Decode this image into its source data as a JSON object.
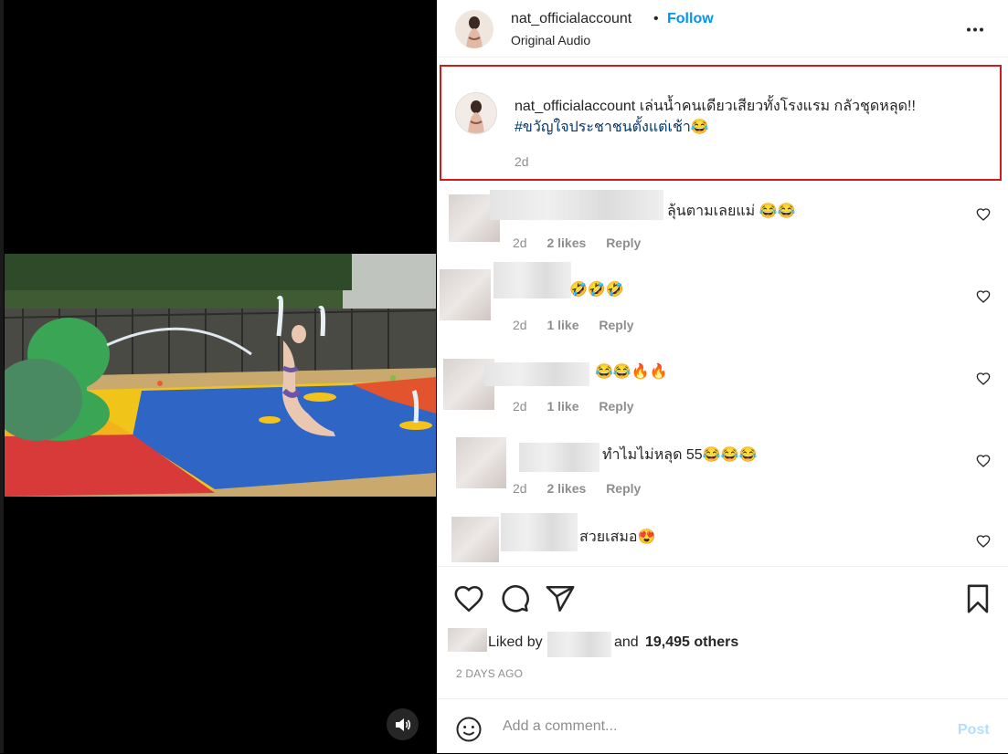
{
  "post": {
    "username": "nat_officialaccount",
    "dot": "•",
    "follow_label": "Follow",
    "audio_label": "Original Audio"
  },
  "caption": {
    "username": "nat_officialaccount",
    "text": "เล่นน้ำคนเดียวเสียวทั้งโรงแรม กลัวชุดหลุด!!",
    "hashtag": "#ขวัญใจประชาชนตั้งแต่เช้า😂",
    "time": "2d"
  },
  "comments": [
    {
      "text": "ลุ้นตามเลยแม่ 😂😂",
      "time": "2d",
      "likes": "2 likes",
      "reply": "Reply"
    },
    {
      "text": "🤣🤣🤣",
      "time": "2d",
      "likes": "1 like",
      "reply": "Reply"
    },
    {
      "text": "😂😂🔥🔥",
      "time": "2d",
      "likes": "1 like",
      "reply": "Reply"
    },
    {
      "text": "ทำไมไม่หลุด 55😂😂😂",
      "time": "2d",
      "likes": "2 likes",
      "reply": "Reply"
    },
    {
      "text": "สวยเสมอ😍",
      "time": "",
      "likes": "",
      "reply": ""
    }
  ],
  "likes": {
    "prefix": "Liked by",
    "and": "and",
    "count": "19,495 others"
  },
  "date_label": "2 DAYS AGO",
  "comment_box": {
    "placeholder": "Add a comment...",
    "post_label": "Post"
  },
  "colors": {
    "accent": "#0095f6",
    "highlight_border": "#d11b1b",
    "hashtag": "#00376b",
    "muted": "#8e8e8e"
  }
}
